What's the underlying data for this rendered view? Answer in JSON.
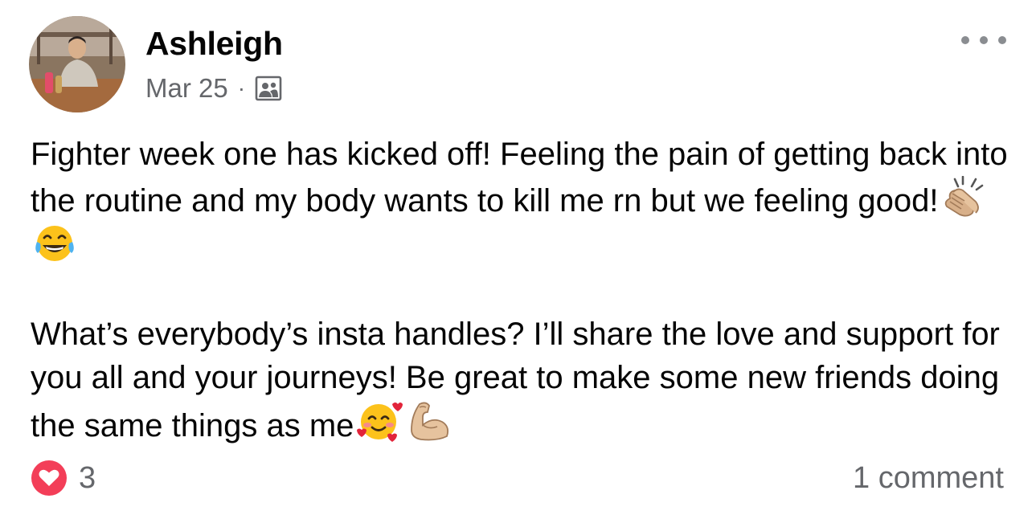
{
  "post": {
    "author": "Ashleigh",
    "date": "Mar 25",
    "separator": "·",
    "audience_icon": "group-icon",
    "paragraphs": [
      "Fighter week one has kicked off! Feeling the pain of getting back into the routine and my body wants to kill me rn but we feeling good!",
      "What’s everybody’s insta handles? I’ll share the love and support for you all and your journeys! Be great to make some new friends doing the same things as me"
    ],
    "emojis": {
      "paragraph_1": [
        "clapping-hands-emoji",
        "tears-of-joy-emoji"
      ],
      "paragraph_2": [
        "smiling-face-with-hearts-emoji",
        "flexed-biceps-emoji"
      ]
    }
  },
  "footer": {
    "reaction_icon": "love-icon",
    "reaction_color": "#f33e58",
    "reaction_count": "3",
    "comment_count": "1 comment"
  },
  "colors": {
    "text_primary": "#050505",
    "text_secondary": "#65676b",
    "icon_gray": "#8a8d91"
  },
  "icons": {
    "more": "more-options-icon"
  }
}
